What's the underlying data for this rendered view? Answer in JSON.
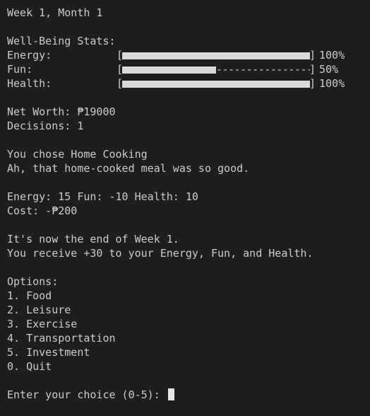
{
  "header": {
    "week_month": "Week 1, Month 1"
  },
  "stats": {
    "title": "Well-Being Stats:",
    "items": [
      {
        "label": "Energy:",
        "percent_text": "100%",
        "fraction": 1.0
      },
      {
        "label": "Fun:",
        "percent_text": "50%",
        "fraction": 0.5
      },
      {
        "label": "Health:",
        "percent_text": "100%",
        "fraction": 1.0
      }
    ],
    "bracket_left": "[",
    "bracket_right": "]"
  },
  "summary": {
    "net_worth": "Net Worth: ₱19000",
    "decisions": "Decisions: 1"
  },
  "choice": {
    "chosen": "You chose Home Cooking",
    "message": "Ah, that home-cooked meal was so good."
  },
  "effects": {
    "deltas": "Energy: 15 Fun: -10 Health: 10",
    "cost": "Cost: -₱200"
  },
  "week_end": {
    "notice": "It's now the end of Week 1.",
    "bonus": "You receive +30 to your Energy, Fun, and Health."
  },
  "menu": {
    "title": "Options:",
    "options": [
      "1. Food",
      "2. Leisure",
      "3. Exercise",
      "4. Transportation",
      "5. Investment",
      "0. Quit"
    ]
  },
  "prompt": {
    "text": "Enter your choice (0-5): "
  }
}
